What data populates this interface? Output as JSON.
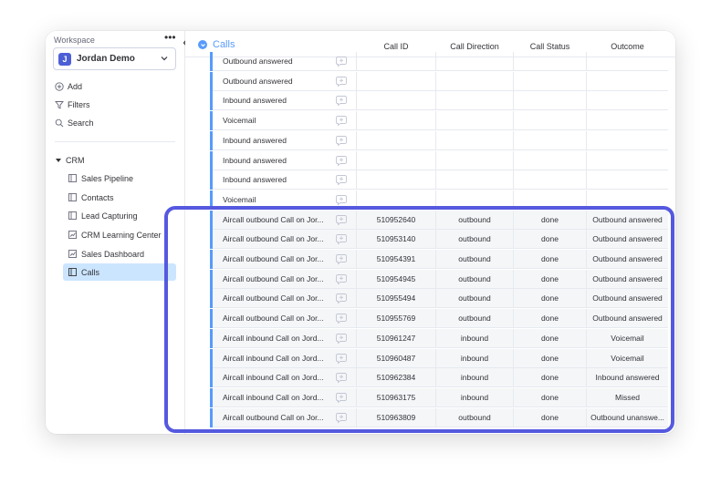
{
  "sidebar": {
    "workspace_label": "Workspace",
    "more_icon": "more-dots-icon",
    "workspace_initial": "J",
    "workspace_name": "Jordan Demo",
    "workspace_color": "#4d5fd6",
    "actions": [
      {
        "label": "Add",
        "icon": "plus-circle-icon"
      },
      {
        "label": "Filters",
        "icon": "filter-icon"
      },
      {
        "label": "Search",
        "icon": "search-icon"
      }
    ],
    "folder": "CRM",
    "boards": [
      {
        "label": "Sales Pipeline",
        "icon": "board-icon",
        "active": false
      },
      {
        "label": "Contacts",
        "icon": "board-icon",
        "active": false
      },
      {
        "label": "Lead Capturing",
        "icon": "board-icon",
        "active": false
      },
      {
        "label": "CRM Learning Center",
        "icon": "dashboard-icon",
        "active": false
      },
      {
        "label": "Sales Dashboard",
        "icon": "dashboard-icon",
        "active": false
      },
      {
        "label": "Calls",
        "icon": "board-icon",
        "active": true
      }
    ]
  },
  "group": {
    "title": "Calls",
    "color": "#579bfc"
  },
  "columns": {
    "call_id": "Call ID",
    "direction": "Call Direction",
    "status": "Call Status",
    "outcome": "Outcome"
  },
  "rows": [
    {
      "name": "Outbound answered",
      "id": "",
      "dir": "",
      "status": "",
      "outcome": ""
    },
    {
      "name": "Outbound answered",
      "id": "",
      "dir": "",
      "status": "",
      "outcome": ""
    },
    {
      "name": "Inbound answered",
      "id": "",
      "dir": "",
      "status": "",
      "outcome": ""
    },
    {
      "name": "Voicemail",
      "id": "",
      "dir": "",
      "status": "",
      "outcome": ""
    },
    {
      "name": "Inbound answered",
      "id": "",
      "dir": "",
      "status": "",
      "outcome": ""
    },
    {
      "name": "Inbound answered",
      "id": "",
      "dir": "",
      "status": "",
      "outcome": ""
    },
    {
      "name": "Inbound answered",
      "id": "",
      "dir": "",
      "status": "",
      "outcome": ""
    },
    {
      "name": "Voicemail",
      "id": "",
      "dir": "",
      "status": "",
      "outcome": ""
    },
    {
      "name": "Aircall outbound Call on Jor...",
      "id": "510952640",
      "dir": "outbound",
      "status": "done",
      "outcome": "Outbound answered"
    },
    {
      "name": "Aircall outbound Call on Jor...",
      "id": "510953140",
      "dir": "outbound",
      "status": "done",
      "outcome": "Outbound answered"
    },
    {
      "name": "Aircall outbound Call on Jor...",
      "id": "510954391",
      "dir": "outbound",
      "status": "done",
      "outcome": "Outbound answered"
    },
    {
      "name": "Aircall outbound Call on Jor...",
      "id": "510954945",
      "dir": "outbound",
      "status": "done",
      "outcome": "Outbound answered"
    },
    {
      "name": "Aircall outbound Call on Jor...",
      "id": "510955494",
      "dir": "outbound",
      "status": "done",
      "outcome": "Outbound answered"
    },
    {
      "name": "Aircall outbound Call on Jor...",
      "id": "510955769",
      "dir": "outbound",
      "status": "done",
      "outcome": "Outbound answered"
    },
    {
      "name": "Aircall inbound Call on Jord...",
      "id": "510961247",
      "dir": "inbound",
      "status": "done",
      "outcome": "Voicemail"
    },
    {
      "name": "Aircall inbound Call on Jord...",
      "id": "510960487",
      "dir": "inbound",
      "status": "done",
      "outcome": "Voicemail"
    },
    {
      "name": "Aircall inbound Call on Jord...",
      "id": "510962384",
      "dir": "inbound",
      "status": "done",
      "outcome": "Inbound answered"
    },
    {
      "name": "Aircall inbound Call on Jord...",
      "id": "510963175",
      "dir": "inbound",
      "status": "done",
      "outcome": "Missed"
    },
    {
      "name": "Aircall outbound Call on Jor...",
      "id": "510963809",
      "dir": "outbound",
      "status": "done",
      "outcome": "Outbound unanswe..."
    }
  ],
  "highlight_color": "#5559df"
}
